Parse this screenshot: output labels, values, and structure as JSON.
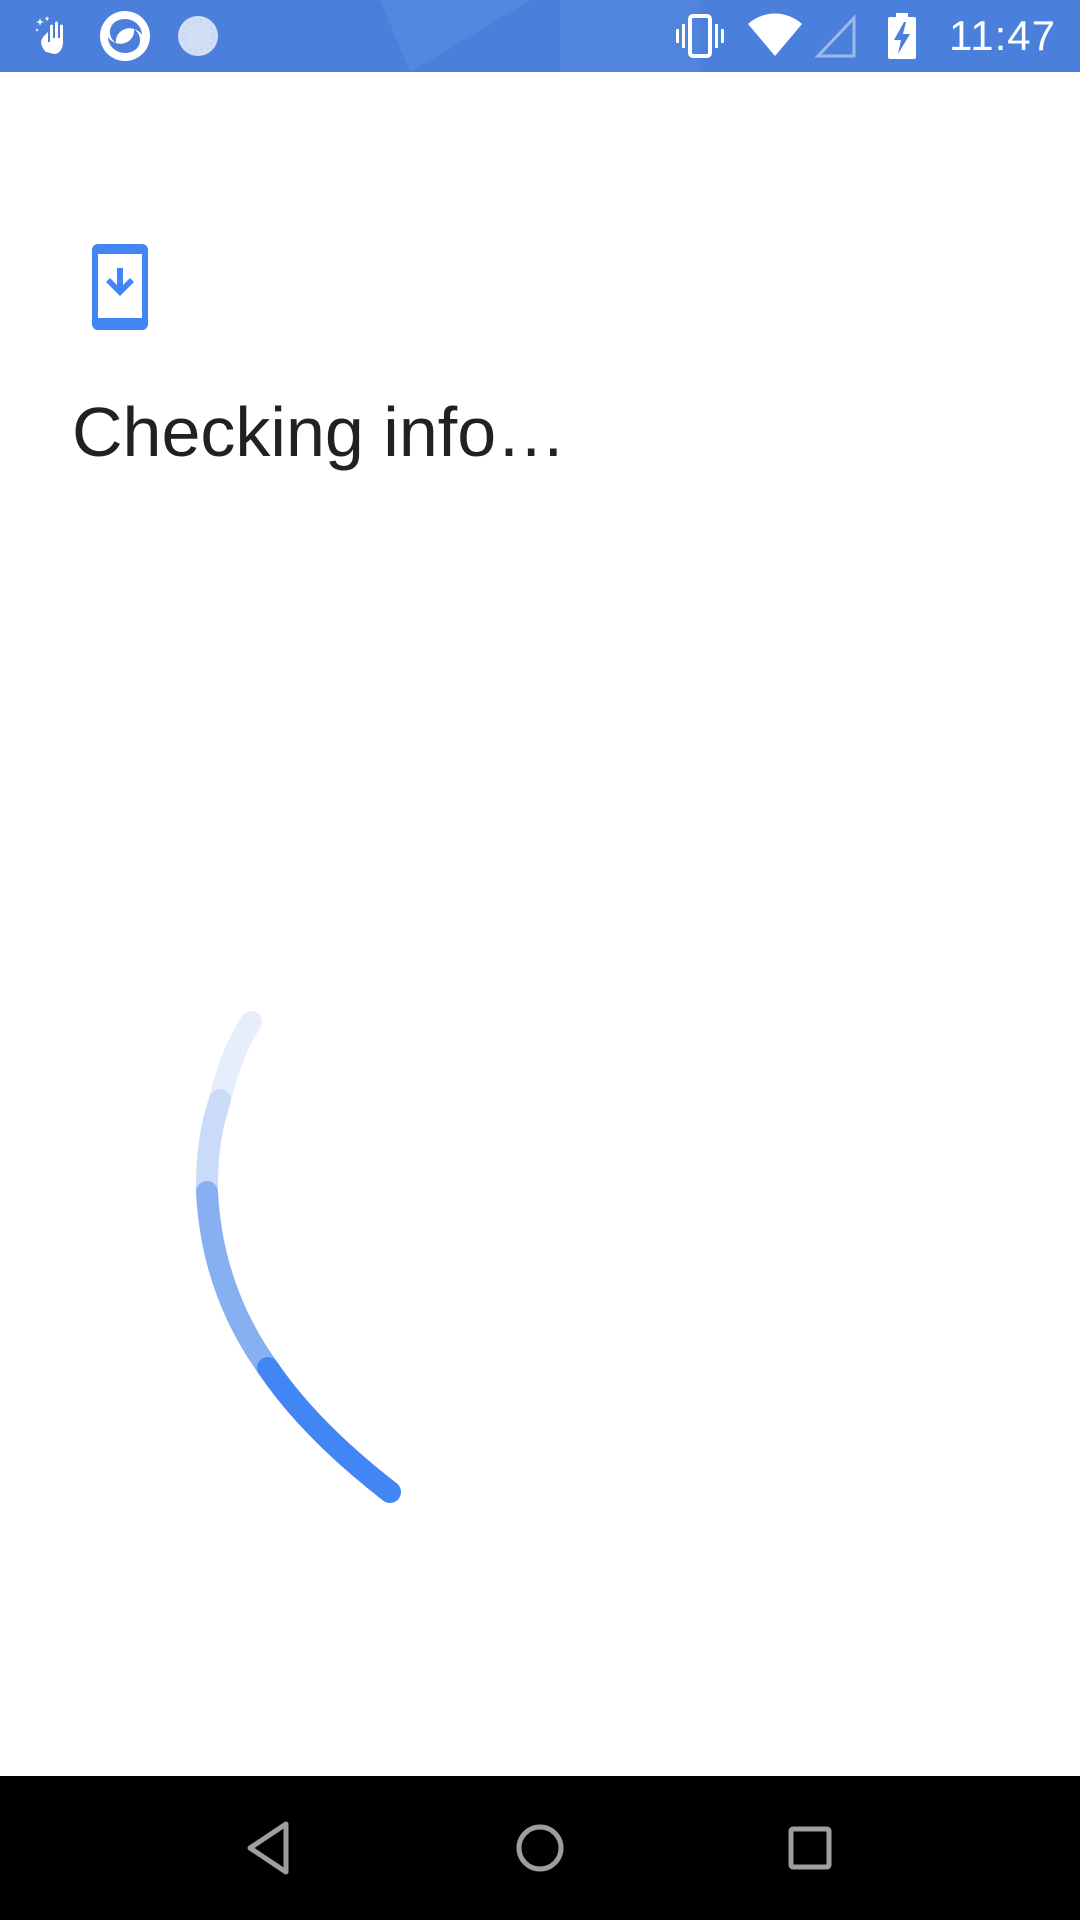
{
  "status_bar": {
    "time": "11:47",
    "background": "#4a80dc",
    "left_icons": [
      "hand-sparkle-icon",
      "app-logo-icon",
      "sync-spinner-icon"
    ],
    "right_icons": [
      "vibrate-icon",
      "wifi-icon",
      "cellular-signal-icon",
      "battery-charging-icon"
    ]
  },
  "content": {
    "icon": "phone-download-icon",
    "title": "Checking info…",
    "accent_color": "#4285f4"
  },
  "progress": {
    "type": "indeterminate-spinner"
  },
  "nav_bar": {
    "buttons": [
      "back-icon",
      "home-icon",
      "recents-icon"
    ]
  }
}
